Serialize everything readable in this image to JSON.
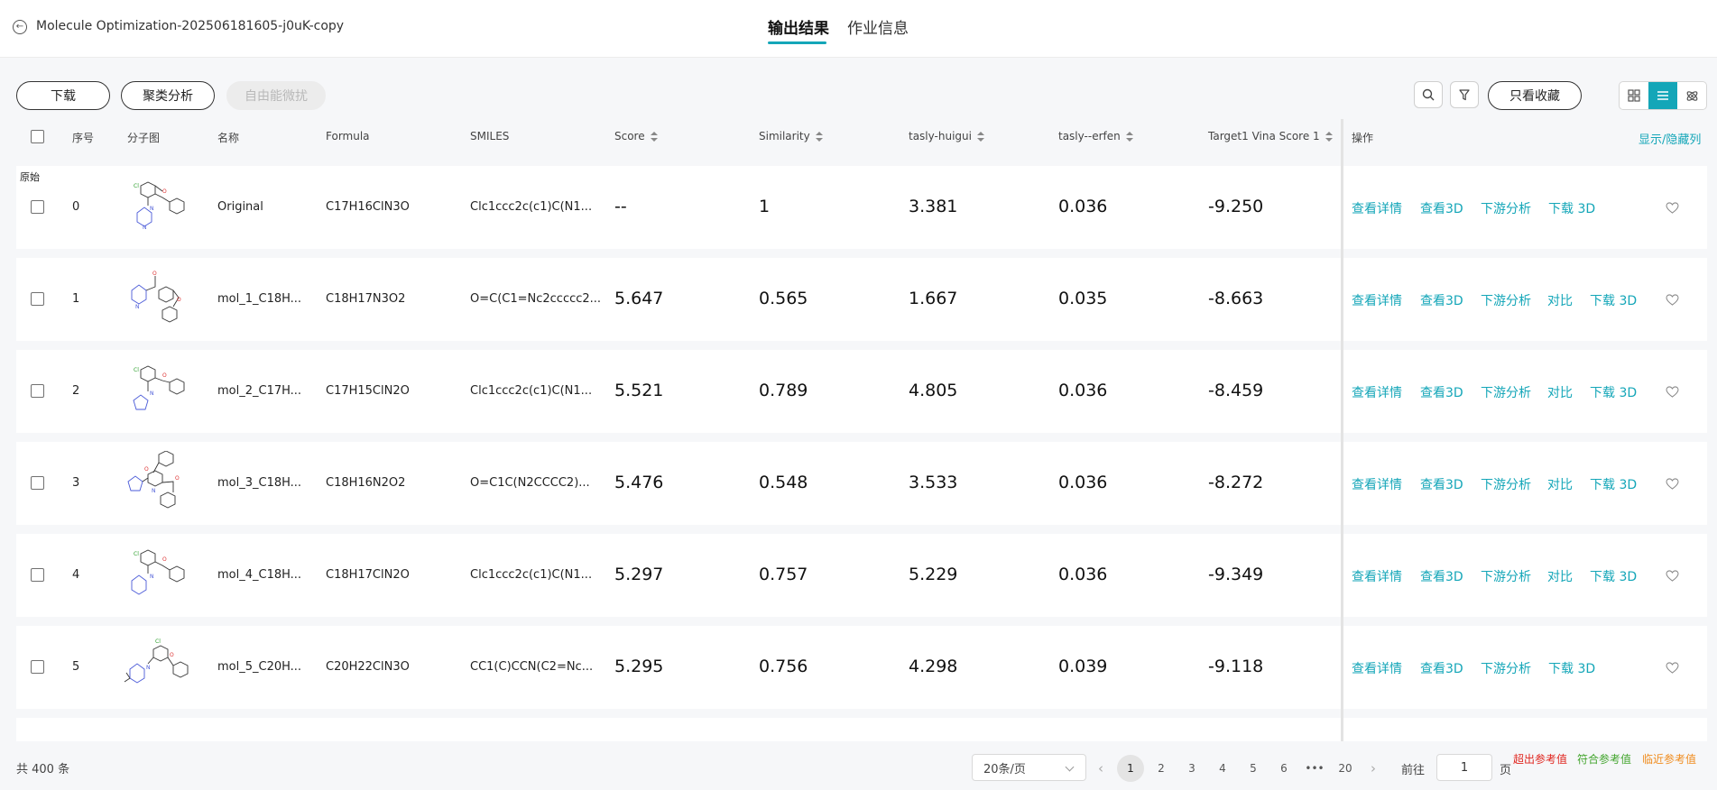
{
  "header": {
    "job_title": "Molecule Optimization-202506181605-j0uK-copy",
    "tabs": [
      {
        "label": "输出结果",
        "active": true
      },
      {
        "label": "作业信息",
        "active": false
      }
    ]
  },
  "toolbar": {
    "download_label": "下载",
    "cluster_label": "聚类分析",
    "fep_label": "自由能微扰",
    "favorites_only_label": "只看收藏"
  },
  "table": {
    "columns": {
      "index": "序号",
      "structure": "分子图",
      "name": "名称",
      "formula": "Formula",
      "smiles": "SMILES",
      "score": "Score",
      "similarity": "Similarity",
      "huigui": "tasly-huigui",
      "erfen": "tasly--erfen",
      "vina": "Target1 Vina Score 1",
      "actions": "操作"
    },
    "toggle_columns_label": "显示/隐藏列",
    "original_tag": "原始",
    "action_labels": {
      "details": "查看详情",
      "view3d": "查看3D",
      "downstream": "下游分析",
      "compare": "对比",
      "download3d": "下载 3D"
    },
    "rows": [
      {
        "idx": "0",
        "name": "Original",
        "formula": "C17H16ClN3O",
        "smiles": "Clc1ccc2c(c1)C(N1...",
        "score": "--",
        "similarity": "1",
        "huigui": "3.381",
        "erfen": "0.036",
        "vina": "-9.250",
        "compare": false
      },
      {
        "idx": "1",
        "name": "mol_1_C18H...",
        "formula": "C18H17N3O2",
        "smiles": "O=C(C1=Nc2ccccc2...",
        "score": "5.647",
        "similarity": "0.565",
        "huigui": "1.667",
        "erfen": "0.035",
        "vina": "-8.663",
        "compare": true
      },
      {
        "idx": "2",
        "name": "mol_2_C17H...",
        "formula": "C17H15ClN2O",
        "smiles": "Clc1ccc2c(c1)C(N1...",
        "score": "5.521",
        "similarity": "0.789",
        "huigui": "4.805",
        "erfen": "0.036",
        "vina": "-8.459",
        "compare": true
      },
      {
        "idx": "3",
        "name": "mol_3_C18H...",
        "formula": "C18H16N2O2",
        "smiles": "O=C1C(N2CCCC2)...",
        "score": "5.476",
        "similarity": "0.548",
        "huigui": "3.533",
        "erfen": "0.036",
        "vina": "-8.272",
        "compare": true
      },
      {
        "idx": "4",
        "name": "mol_4_C18H...",
        "formula": "C18H17ClN2O",
        "smiles": "Clc1ccc2c(c1)C(N1...",
        "score": "5.297",
        "similarity": "0.757",
        "huigui": "5.229",
        "erfen": "0.036",
        "vina": "-9.349",
        "compare": true
      },
      {
        "idx": "5",
        "name": "mol_5_C20H...",
        "formula": "C20H22ClN3O",
        "smiles": "CC1(C)CCN(C2=Nc...",
        "score": "5.295",
        "similarity": "0.756",
        "huigui": "4.298",
        "erfen": "0.039",
        "vina": "-9.118",
        "compare": false
      }
    ]
  },
  "footer": {
    "total": "共 400 条",
    "page_size": "20条/页",
    "pages": [
      "1",
      "2",
      "3",
      "4",
      "5",
      "6",
      "•••",
      "20"
    ],
    "current_page": "1",
    "goto_prefix": "前往",
    "goto_value": "1",
    "goto_suffix": "页",
    "legend": [
      {
        "label": "超出参考值",
        "color": "#e0261f"
      },
      {
        "label": "符合参考值",
        "color": "#43a52e"
      },
      {
        "label": "临近参考值",
        "color": "#f08c1e"
      }
    ]
  },
  "colors": {
    "accent": "#14a6b8"
  }
}
